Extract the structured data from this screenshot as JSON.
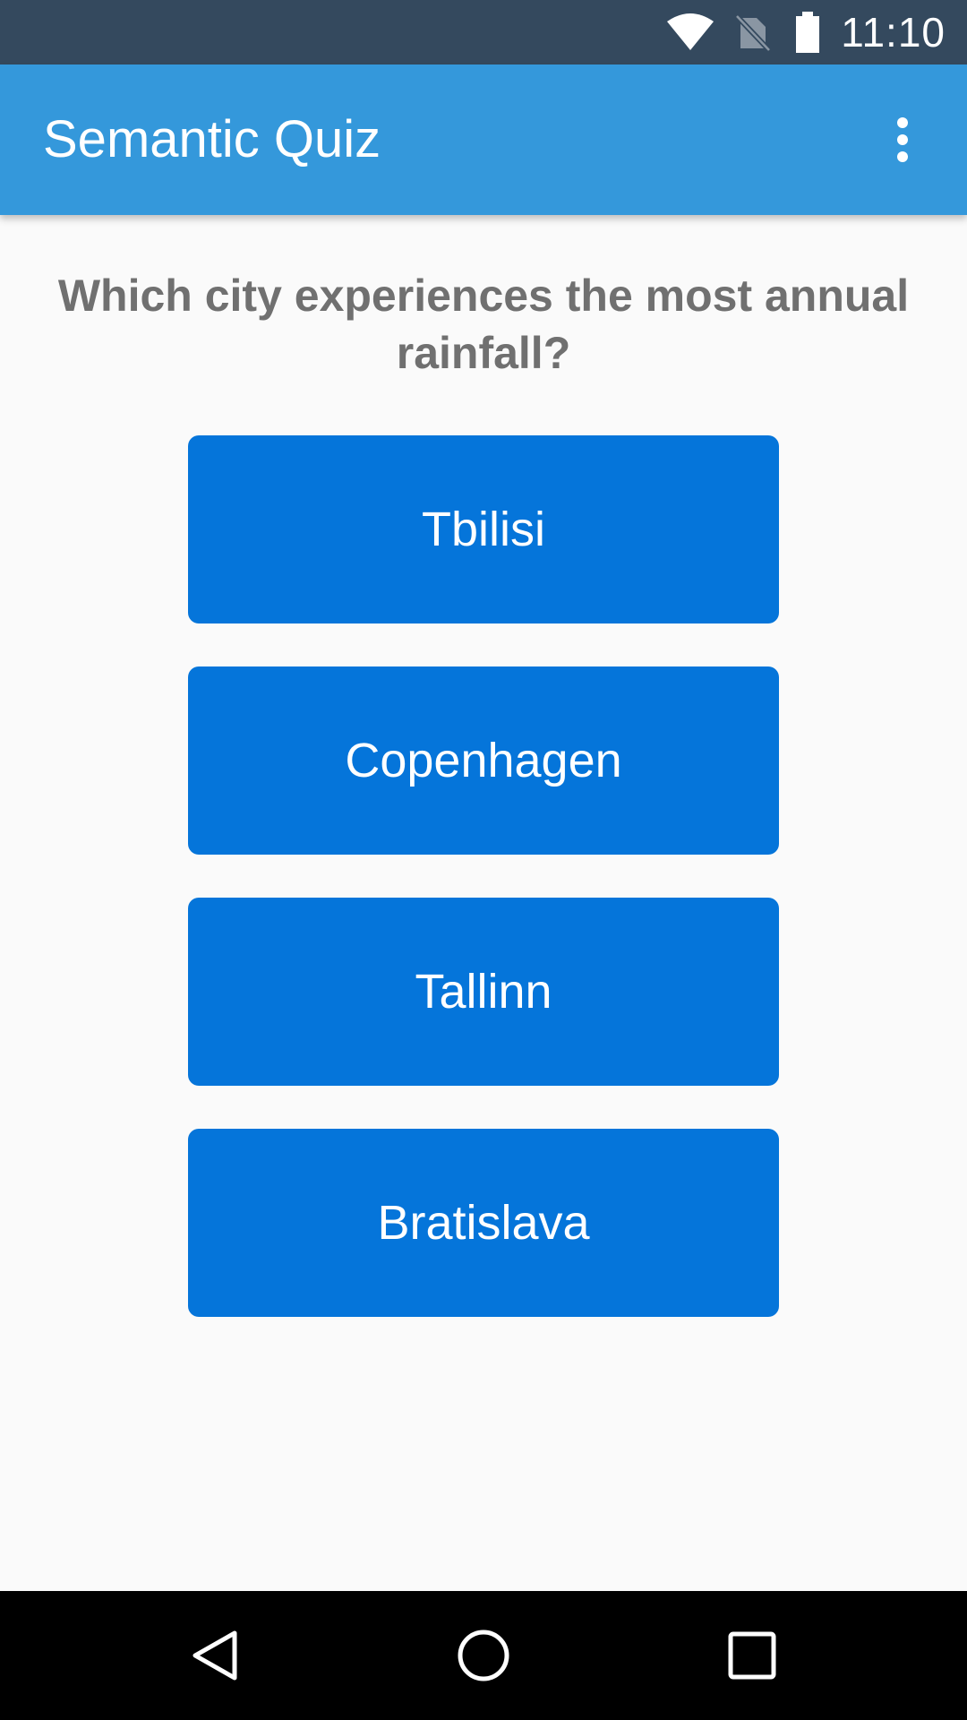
{
  "status_bar": {
    "time": "11:10",
    "icons": [
      "wifi-icon",
      "no-sim-icon",
      "battery-icon"
    ]
  },
  "app_bar": {
    "title": "Semantic Quiz",
    "menu_icon": "more-vert-icon"
  },
  "quiz": {
    "question": "Which city experiences the most annual rainfall?",
    "answers": [
      {
        "label": "Tbilisi"
      },
      {
        "label": "Copenhagen"
      },
      {
        "label": "Tallinn"
      },
      {
        "label": "Bratislava"
      }
    ]
  },
  "nav_bar": {
    "icons": [
      "back-icon",
      "home-icon",
      "recents-icon"
    ]
  },
  "colors": {
    "status_bar": "#34495e",
    "app_bar": "#3498db",
    "button": "#0575da",
    "background": "#fafafa",
    "question_text": "#707070",
    "nav_bar": "#000000"
  }
}
